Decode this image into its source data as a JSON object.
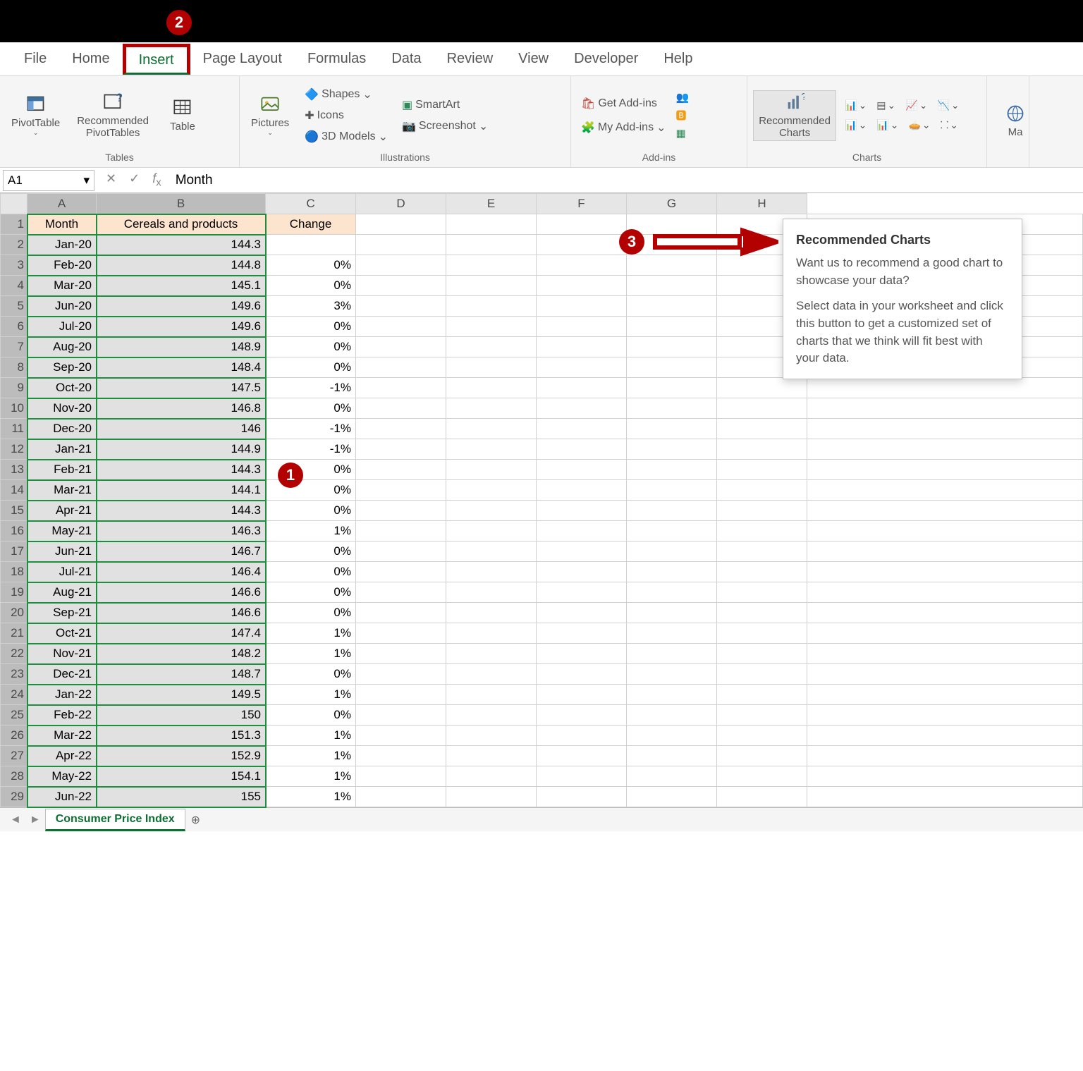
{
  "tabs": {
    "file": "File",
    "home": "Home",
    "insert": "Insert",
    "page_layout": "Page Layout",
    "formulas": "Formulas",
    "data": "Data",
    "review": "Review",
    "view": "View",
    "developer": "Developer",
    "help": "Help"
  },
  "ribbon": {
    "tables": {
      "label": "Tables",
      "pivot": "PivotTable",
      "recp": "Recommended\nPivotTables",
      "table": "Table"
    },
    "illus": {
      "label": "Illustrations",
      "pictures": "Pictures",
      "shapes": "Shapes",
      "icons": "Icons",
      "models": "3D Models",
      "smartart": "SmartArt",
      "screenshot": "Screenshot"
    },
    "addins": {
      "label": "Add-ins",
      "get": "Get Add-ins",
      "my": "My Add-ins"
    },
    "charts": {
      "label": "Charts",
      "rec": "Recommended\nCharts",
      "maps": "Ma"
    }
  },
  "namebox": "A1",
  "formula": "Month",
  "headers": [
    "A",
    "B",
    "C",
    "D",
    "E",
    "F",
    "G",
    "H"
  ],
  "sheet": {
    "name": "Consumer Price Index"
  },
  "callouts": {
    "one": "1",
    "two": "2",
    "three": "3"
  },
  "tooltip": {
    "title": "Recommended Charts",
    "p1": "Want us to recommend a good chart to showcase your data?",
    "p2": "Select data in your worksheet and click this button to get a customized set of charts that we think will fit best with your data."
  },
  "rows": [
    {
      "r": 1,
      "a": "Month",
      "b": "Cereals and products",
      "c": "Change",
      "hdr": true
    },
    {
      "r": 2,
      "a": "Jan-20",
      "b": "144.3",
      "c": ""
    },
    {
      "r": 3,
      "a": "Feb-20",
      "b": "144.8",
      "c": "0%"
    },
    {
      "r": 4,
      "a": "Mar-20",
      "b": "145.1",
      "c": "0%"
    },
    {
      "r": 5,
      "a": "Jun-20",
      "b": "149.6",
      "c": "3%"
    },
    {
      "r": 6,
      "a": "Jul-20",
      "b": "149.6",
      "c": "0%"
    },
    {
      "r": 7,
      "a": "Aug-20",
      "b": "148.9",
      "c": "0%"
    },
    {
      "r": 8,
      "a": "Sep-20",
      "b": "148.4",
      "c": "0%"
    },
    {
      "r": 9,
      "a": "Oct-20",
      "b": "147.5",
      "c": "-1%"
    },
    {
      "r": 10,
      "a": "Nov-20",
      "b": "146.8",
      "c": "0%"
    },
    {
      "r": 11,
      "a": "Dec-20",
      "b": "146",
      "c": "-1%"
    },
    {
      "r": 12,
      "a": "Jan-21",
      "b": "144.9",
      "c": "-1%"
    },
    {
      "r": 13,
      "a": "Feb-21",
      "b": "144.3",
      "c": "0%"
    },
    {
      "r": 14,
      "a": "Mar-21",
      "b": "144.1",
      "c": "0%"
    },
    {
      "r": 15,
      "a": "Apr-21",
      "b": "144.3",
      "c": "0%"
    },
    {
      "r": 16,
      "a": "May-21",
      "b": "146.3",
      "c": "1%"
    },
    {
      "r": 17,
      "a": "Jun-21",
      "b": "146.7",
      "c": "0%"
    },
    {
      "r": 18,
      "a": "Jul-21",
      "b": "146.4",
      "c": "0%"
    },
    {
      "r": 19,
      "a": "Aug-21",
      "b": "146.6",
      "c": "0%"
    },
    {
      "r": 20,
      "a": "Sep-21",
      "b": "146.6",
      "c": "0%"
    },
    {
      "r": 21,
      "a": "Oct-21",
      "b": "147.4",
      "c": "1%"
    },
    {
      "r": 22,
      "a": "Nov-21",
      "b": "148.2",
      "c": "1%"
    },
    {
      "r": 23,
      "a": "Dec-21",
      "b": "148.7",
      "c": "0%"
    },
    {
      "r": 24,
      "a": "Jan-22",
      "b": "149.5",
      "c": "1%"
    },
    {
      "r": 25,
      "a": "Feb-22",
      "b": "150",
      "c": "0%"
    },
    {
      "r": 26,
      "a": "Mar-22",
      "b": "151.3",
      "c": "1%"
    },
    {
      "r": 27,
      "a": "Apr-22",
      "b": "152.9",
      "c": "1%"
    },
    {
      "r": 28,
      "a": "May-22",
      "b": "154.1",
      "c": "1%"
    },
    {
      "r": 29,
      "a": "Jun-22",
      "b": "155",
      "c": "1%"
    }
  ]
}
